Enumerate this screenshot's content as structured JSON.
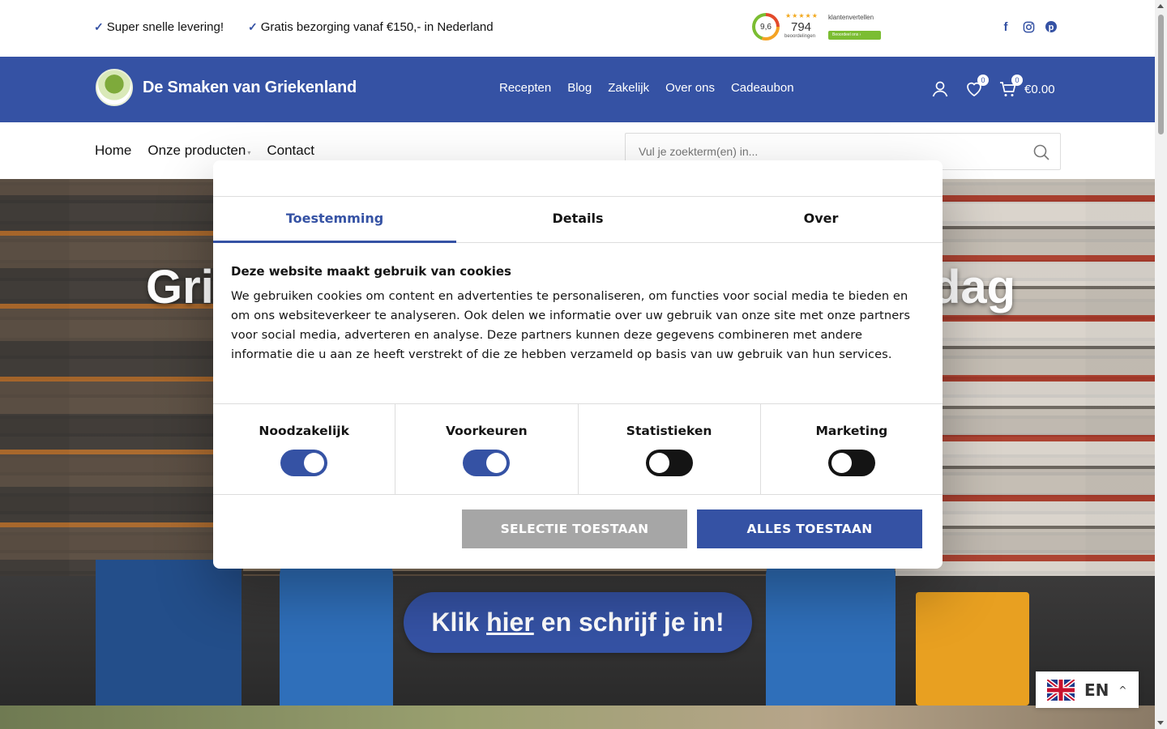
{
  "topbar": {
    "usp1": "Super snelle levering!",
    "usp2": "Gratis bezorging vanaf €150,- in Nederland",
    "rating": {
      "score": "9,6",
      "stars": "★★★★★",
      "count": "794",
      "count_label": "beoordelingen",
      "brand": "klantenvertellen",
      "rate_button": "Beoordeel ons"
    },
    "socials": [
      "facebook-icon",
      "instagram-icon",
      "pinterest-icon"
    ]
  },
  "header": {
    "logo_text": "De Smaken van Griekenland",
    "nav": [
      "Recepten",
      "Blog",
      "Zakelijk",
      "Over ons",
      "Cadeaubon"
    ],
    "wishlist_count": "0",
    "cart_count": "0",
    "cart_total": "€0.00",
    "brand_color": "#3552a4"
  },
  "subnav": {
    "links": [
      "Home",
      "Onze producten",
      "Contact"
    ],
    "search_placeholder": "Vul je zoekterm(en) in..."
  },
  "hero": {
    "title_left": "Gri",
    "title_right": "dag",
    "cta_prefix": "Klik",
    "cta_link": "hier",
    "cta_suffix": "en schrijf je in!"
  },
  "cookie_dialog": {
    "tabs": [
      "Toestemming",
      "Details",
      "Over"
    ],
    "active_tab": "Toestemming",
    "heading": "Deze website maakt gebruik van cookies",
    "text": "We gebruiken cookies om content en advertenties te personaliseren, om functies voor social media te bieden en om ons websiteverkeer te analyseren. Ook delen we informatie over uw gebruik van onze site met onze partners voor social media, adverteren en analyse. Deze partners kunnen deze gegevens combineren met andere informatie die u aan ze heeft verstrekt of die ze hebben verzameld op basis van uw gebruik van hun services.",
    "toggles": [
      {
        "label": "Noodzakelijk",
        "on": true
      },
      {
        "label": "Voorkeuren",
        "on": true
      },
      {
        "label": "Statistieken",
        "on": false
      },
      {
        "label": "Marketing",
        "on": false
      }
    ],
    "btn_selection": "SELECTIE TOESTAAN",
    "btn_all": "ALLES TOESTAAN"
  },
  "language": {
    "code": "EN",
    "chevron": "^"
  }
}
